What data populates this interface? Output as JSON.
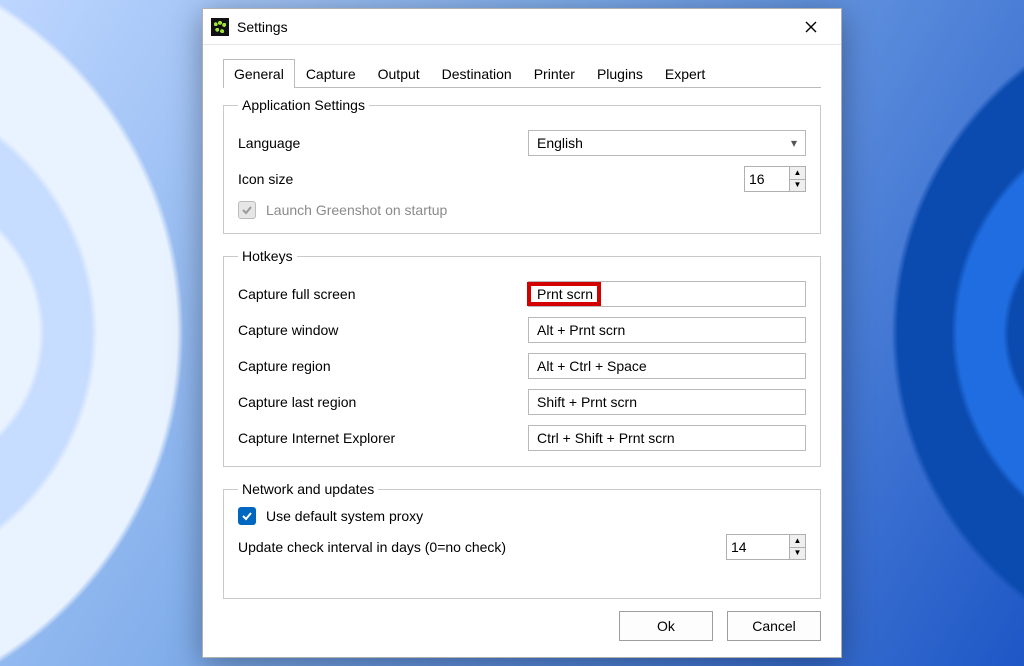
{
  "window": {
    "title": "Settings"
  },
  "tabs": {
    "general": "General",
    "capture": "Capture",
    "output": "Output",
    "destination": "Destination",
    "printer": "Printer",
    "plugins": "Plugins",
    "expert": "Expert"
  },
  "app_settings": {
    "legend": "Application Settings",
    "language_label": "Language",
    "language_value": "English",
    "icon_size_label": "Icon size",
    "icon_size_value": "16",
    "launch_on_startup_label": "Launch Greenshot on startup"
  },
  "hotkeys": {
    "legend": "Hotkeys",
    "full_screen_label": "Capture full screen",
    "full_screen_value": "Prnt scrn",
    "window_label": "Capture window",
    "window_value": "Alt + Prnt scrn",
    "region_label": "Capture region",
    "region_value": "Alt + Ctrl + Space",
    "last_region_label": "Capture last region",
    "last_region_value": "Shift + Prnt scrn",
    "ie_label": "Capture Internet Explorer",
    "ie_value": "Ctrl + Shift + Prnt scrn"
  },
  "network": {
    "legend": "Network and updates",
    "proxy_label": "Use default system proxy",
    "update_interval_label": "Update check interval in days (0=no check)",
    "update_interval_value": "14"
  },
  "buttons": {
    "ok": "Ok",
    "cancel": "Cancel"
  }
}
